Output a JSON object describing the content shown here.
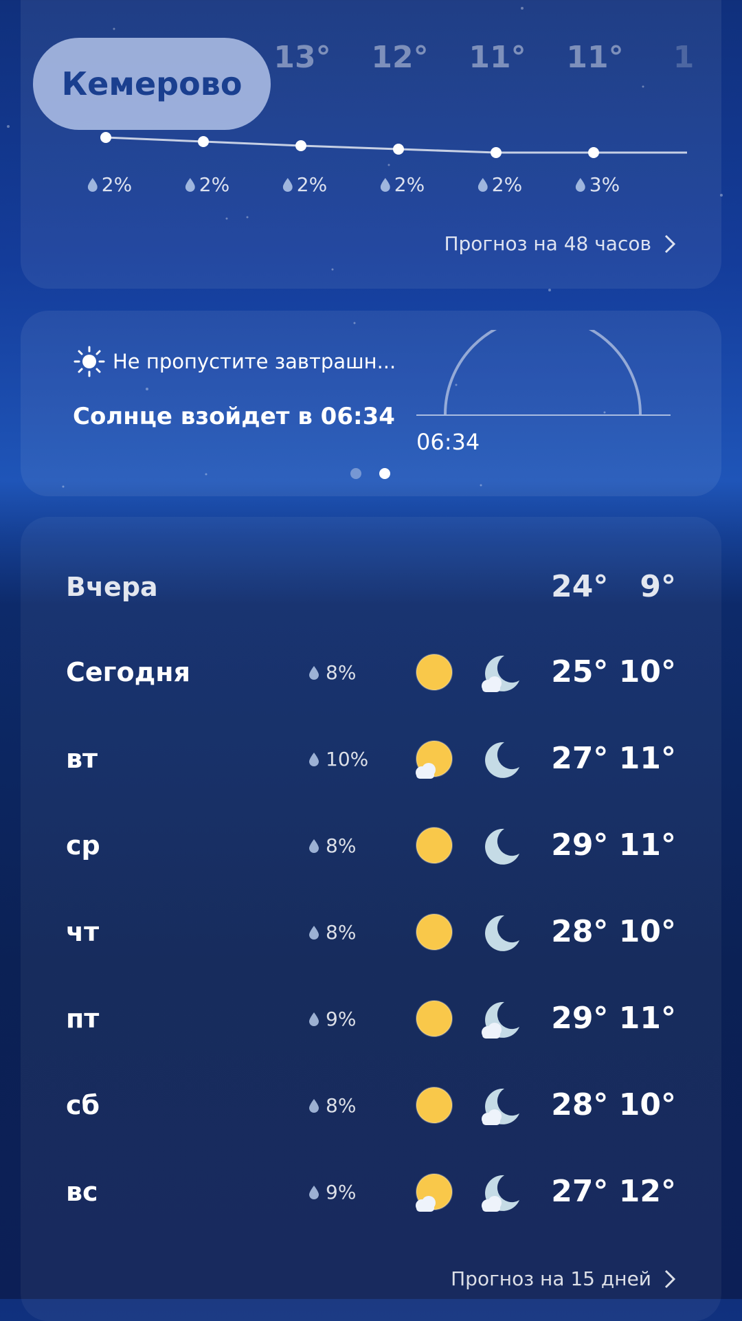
{
  "city": "Кемерово",
  "hourly": {
    "temps": [
      "13°",
      "12°",
      "11°",
      "11°"
    ],
    "precip": [
      "2%",
      "2%",
      "2%",
      "2%",
      "2%",
      "3%"
    ],
    "more_link": "Прогноз на 48 часов"
  },
  "sun": {
    "tip": "Не пропустите завтрашн...",
    "headline": "Солнце взойдет в 06:34",
    "time": "06:34"
  },
  "daily": {
    "yesterday": {
      "label": "Вчера",
      "high": "24°",
      "low": "9°"
    },
    "days": [
      {
        "label": "Сегодня",
        "precip": "8%",
        "day_icon": "sun-icon",
        "night_icon": "moon-cloud-icon",
        "high": "25°",
        "low": "10°"
      },
      {
        "label": "вт",
        "precip": "10%",
        "day_icon": "sun-cloud-icon",
        "night_icon": "moon-icon",
        "high": "27°",
        "low": "11°"
      },
      {
        "label": "ср",
        "precip": "8%",
        "day_icon": "sun-icon",
        "night_icon": "moon-icon",
        "high": "29°",
        "low": "11°"
      },
      {
        "label": "чт",
        "precip": "8%",
        "day_icon": "sun-icon",
        "night_icon": "moon-icon",
        "high": "28°",
        "low": "10°"
      },
      {
        "label": "пт",
        "precip": "9%",
        "day_icon": "sun-icon",
        "night_icon": "moon-cloud-icon",
        "high": "29°",
        "low": "11°"
      },
      {
        "label": "сб",
        "precip": "8%",
        "day_icon": "sun-icon",
        "night_icon": "moon-cloud-icon",
        "high": "28°",
        "low": "10°"
      },
      {
        "label": "вс",
        "precip": "9%",
        "day_icon": "sun-cloud-icon",
        "night_icon": "moon-cloud-icon",
        "high": "27°",
        "low": "12°"
      }
    ],
    "more_link": "Прогноз на 15 дней"
  },
  "colors": {
    "sun": "#f9c84a",
    "moon": "#c5dbe6",
    "accent_pill": "#bccdf0"
  }
}
